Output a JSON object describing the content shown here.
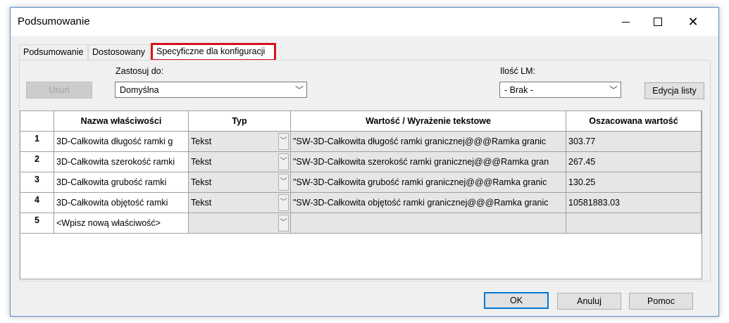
{
  "window": {
    "title": "Podsumowanie"
  },
  "tabs": [
    {
      "label": "Podsumowanie"
    },
    {
      "label": "Dostosowany"
    },
    {
      "label": "Specyficzne dla konfiguracji"
    }
  ],
  "toolbar": {
    "apply_label": "Zastosuj do:",
    "apply_value": "Domyślna",
    "lm_label": "Ilość LM:",
    "lm_value": "- Brak -",
    "delete_button": "Usuń",
    "edit_list_button": "Edycja listy"
  },
  "table": {
    "headers": [
      "Nazwa właściwości",
      "Typ",
      "Wartość / Wyrażenie tekstowe",
      "Oszacowana wartość"
    ],
    "rows": [
      {
        "num": "1",
        "name": "3D-Całkowita długość ramki g",
        "type": "Tekst",
        "expr": "\"SW-3D-Całkowita długość ramki granicznej@@@Ramka granic",
        "value": "303.77"
      },
      {
        "num": "2",
        "name": "3D-Całkowita szerokość ramki",
        "type": "Tekst",
        "expr": "\"SW-3D-Całkowita szerokość ramki granicznej@@@Ramka gran",
        "value": "267.45"
      },
      {
        "num": "3",
        "name": "3D-Całkowita grubość ramki",
        "type": "Tekst",
        "expr": "\"SW-3D-Całkowita grubość ramki granicznej@@@Ramka granic",
        "value": "130.25"
      },
      {
        "num": "4",
        "name": "3D-Całkowita objętość ramki",
        "type": "Tekst",
        "expr": "\"SW-3D-Całkowita objętość ramki granicznej@@@Ramka granic",
        "value": "10581883.03"
      },
      {
        "num": "5",
        "name": "<Wpisz nową właściwość>",
        "type": "",
        "expr": "",
        "value": ""
      }
    ]
  },
  "footer": {
    "ok": "OK",
    "cancel": "Anuluj",
    "help": "Pomoc"
  }
}
